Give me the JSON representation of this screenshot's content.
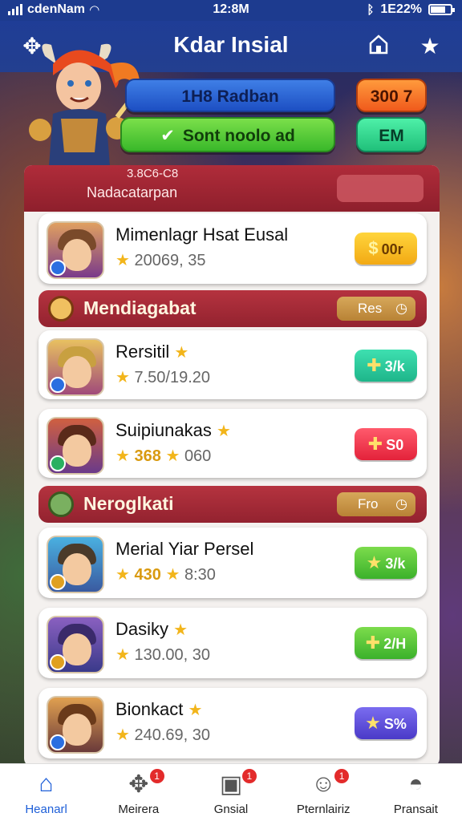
{
  "status_bar": {
    "carrier": "cdenNam",
    "time": "12:8M",
    "battery": "1E22%"
  },
  "header": {
    "title": "Kdar Insial",
    "left_icon": "puzzle-icon",
    "right_icons": [
      "home-icon",
      "star-icon"
    ]
  },
  "hero": {
    "blue_pill": "1H8 Radban",
    "green_pill": "Sont noolo ad",
    "orange_pill": "300 7",
    "teal_pill": "EM"
  },
  "panel_header": {
    "line1": "3.8C6-C8",
    "line2": "Nadacatarpan"
  },
  "cards": [
    {
      "name": "Mimenlagr Hsat Eusal",
      "stats": "20069, 35",
      "tag": "00r",
      "tag_color": "#f2b51b"
    },
    {
      "name": "Rersitil",
      "stats": "7.50/19.20",
      "tag": "3/k",
      "tag_color": "#1eb58a"
    },
    {
      "name": "Suipiunakas",
      "stats_a": "368",
      "stats_b": "060",
      "tag": "S0",
      "tag_color": "#e3223a"
    },
    {
      "name": "Merial Yiar Persel",
      "stats_a": "430",
      "stats_b": "8:30",
      "tag": "3/k",
      "tag_color": "#3bb12b"
    },
    {
      "name": "Dasiky",
      "stats": "130.00, 30",
      "tag": "2/H",
      "tag_color": "#3bb12b"
    },
    {
      "name": "Bionkact",
      "stats": "240.69, 30",
      "tag": "S%",
      "tag_color": "#4a3ac8"
    }
  ],
  "sections": [
    {
      "title": "Mendiagabat",
      "button": "Res"
    },
    {
      "title": "Neroglkati",
      "button": "Fro"
    }
  ],
  "tabs": [
    {
      "label": "Heanarl",
      "icon": "home-icon",
      "badge": ""
    },
    {
      "label": "Meirera",
      "icon": "puzzle-icon",
      "badge": "1"
    },
    {
      "label": "Gnsial",
      "icon": "bag-icon",
      "badge": "1"
    },
    {
      "label": "Pternlairiz",
      "icon": "people-icon",
      "badge": "1"
    },
    {
      "label": "Pransait",
      "icon": "profile-icon",
      "badge": ""
    }
  ]
}
